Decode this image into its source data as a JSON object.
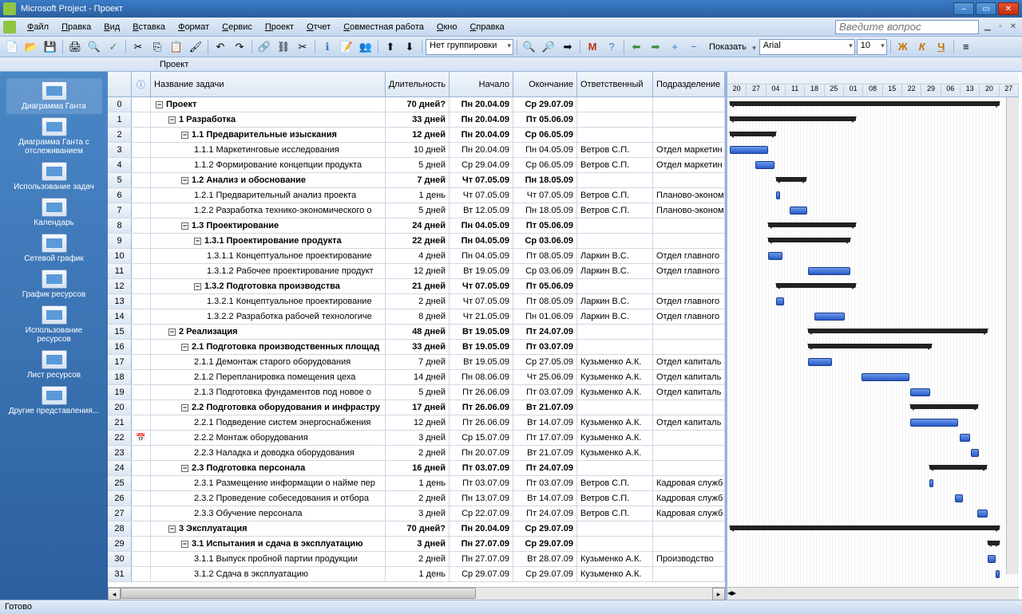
{
  "titlebar": {
    "title": "Microsoft Project - Проект"
  },
  "menu": {
    "items": [
      "Файл",
      "Правка",
      "Вид",
      "Вставка",
      "Формат",
      "Сервис",
      "Проект",
      "Отчет",
      "Совместная работа",
      "Окно",
      "Справка"
    ],
    "question_placeholder": "Введите вопрос"
  },
  "toolbar2": {
    "grouping": "Нет группировки",
    "show_label": "Показать",
    "font_name": "Arial",
    "font_size": "10"
  },
  "docbar": {
    "name": "Проект"
  },
  "sidebar": {
    "items": [
      "Диаграмма Ганта",
      "Диаграмма Ганта с отслеживанием",
      "Использование задач",
      "Календарь",
      "Сетевой график",
      "График ресурсов",
      "Использование ресурсов",
      "Лист ресурсов",
      "Другие представления..."
    ]
  },
  "columns": {
    "info": "",
    "name": "Название задачи",
    "duration": "Длительность",
    "start": "Начало",
    "end": "Окончание",
    "resp": "Ответственный",
    "dept": "Подразделение"
  },
  "gantt_dates": [
    "20",
    "27",
    "04",
    "11",
    "18",
    "25",
    "01",
    "08",
    "15",
    "22",
    "29",
    "06",
    "13",
    "20",
    "27"
  ],
  "tasks": [
    {
      "n": 0,
      "lvl": 0,
      "out": "-",
      "bold": true,
      "name": "Проект",
      "dur": "70 дней?",
      "start": "Пн 20.04.09",
      "end": "Ср 29.07.09",
      "resp": "",
      "dept": "",
      "gtype": "summary",
      "gl": 0,
      "gw": 338
    },
    {
      "n": 1,
      "lvl": 1,
      "out": "-",
      "bold": true,
      "name": "1 Разработка",
      "dur": "33 дней",
      "start": "Пн 20.04.09",
      "end": "Пт 05.06.09",
      "resp": "",
      "dept": "",
      "gtype": "summary",
      "gl": 0,
      "gw": 158
    },
    {
      "n": 2,
      "lvl": 2,
      "out": "-",
      "bold": true,
      "name": "1.1 Предварительные изыскания",
      "dur": "12 дней",
      "start": "Пн 20.04.09",
      "end": "Ср 06.05.09",
      "resp": "",
      "dept": "",
      "gtype": "summary",
      "gl": 0,
      "gw": 58
    },
    {
      "n": 3,
      "lvl": 3,
      "out": "",
      "bold": false,
      "name": "1.1.1 Маркетинговые исследования",
      "dur": "10 дней",
      "start": "Пн 20.04.09",
      "end": "Пн 04.05.09",
      "resp": "Ветров С.П.",
      "dept": "Отдел маркетин",
      "gtype": "task",
      "gl": 0,
      "gw": 48
    },
    {
      "n": 4,
      "lvl": 3,
      "out": "",
      "bold": false,
      "name": "1.1.2 Формирование концепции продукта",
      "dur": "5 дней",
      "start": "Ср 29.04.09",
      "end": "Ср 06.05.09",
      "resp": "Ветров С.П.",
      "dept": "Отдел маркетин",
      "gtype": "task",
      "gl": 32,
      "gw": 24
    },
    {
      "n": 5,
      "lvl": 2,
      "out": "-",
      "bold": true,
      "name": "1.2 Анализ и обоснование",
      "dur": "7 дней",
      "start": "Чт 07.05.09",
      "end": "Пн 18.05.09",
      "resp": "",
      "dept": "",
      "gtype": "summary",
      "gl": 58,
      "gw": 38
    },
    {
      "n": 6,
      "lvl": 3,
      "out": "",
      "bold": false,
      "name": "1.2.1 Предварительный анализ проекта",
      "dur": "1 день",
      "start": "Чт 07.05.09",
      "end": "Чт 07.05.09",
      "resp": "Ветров С.П.",
      "dept": "Планово-эконом",
      "gtype": "task",
      "gl": 58,
      "gw": 5
    },
    {
      "n": 7,
      "lvl": 3,
      "out": "",
      "bold": false,
      "name": "1.2.2 Разработка технико-экономического о",
      "dur": "5 дней",
      "start": "Вт 12.05.09",
      "end": "Пн 18.05.09",
      "resp": "Ветров С.П.",
      "dept": "Планово-эконом",
      "gtype": "task",
      "gl": 75,
      "gw": 22
    },
    {
      "n": 8,
      "lvl": 2,
      "out": "-",
      "bold": true,
      "name": "1.3 Проектирование",
      "dur": "24 дней",
      "start": "Пн 04.05.09",
      "end": "Пт 05.06.09",
      "resp": "",
      "dept": "",
      "gtype": "summary",
      "gl": 48,
      "gw": 110
    },
    {
      "n": 9,
      "lvl": 3,
      "out": "-",
      "bold": true,
      "name": "1.3.1 Проектирование продукта",
      "dur": "22 дней",
      "start": "Пн 04.05.09",
      "end": "Ср 03.06.09",
      "resp": "",
      "dept": "",
      "gtype": "summary",
      "gl": 48,
      "gw": 103
    },
    {
      "n": 10,
      "lvl": 4,
      "out": "",
      "bold": false,
      "name": "1.3.1.1 Концептуальное проектирование",
      "dur": "4 дней",
      "start": "Пн 04.05.09",
      "end": "Пт 08.05.09",
      "resp": "Ларкин В.С.",
      "dept": "Отдел главного",
      "gtype": "task",
      "gl": 48,
      "gw": 18
    },
    {
      "n": 11,
      "lvl": 4,
      "out": "",
      "bold": false,
      "name": "1.3.1.2 Рабочее проектирование продукт",
      "dur": "12 дней",
      "start": "Вт 19.05.09",
      "end": "Ср 03.06.09",
      "resp": "Ларкин В.С.",
      "dept": "Отдел главного",
      "gtype": "task",
      "gl": 98,
      "gw": 53
    },
    {
      "n": 12,
      "lvl": 3,
      "out": "-",
      "bold": true,
      "name": "1.3.2 Подготовка производства",
      "dur": "21 дней",
      "start": "Чт 07.05.09",
      "end": "Пт 05.06.09",
      "resp": "",
      "dept": "",
      "gtype": "summary",
      "gl": 58,
      "gw": 100
    },
    {
      "n": 13,
      "lvl": 4,
      "out": "",
      "bold": false,
      "name": "1.3.2.1 Концептуальное проектирование",
      "dur": "2 дней",
      "start": "Чт 07.05.09",
      "end": "Пт 08.05.09",
      "resp": "Ларкин В.С.",
      "dept": "Отдел главного",
      "gtype": "task",
      "gl": 58,
      "gw": 10
    },
    {
      "n": 14,
      "lvl": 4,
      "out": "",
      "bold": false,
      "name": "1.3.2.2 Разработка рабочей технологиче",
      "dur": "8 дней",
      "start": "Чт 21.05.09",
      "end": "Пн 01.06.09",
      "resp": "Ларкин В.С.",
      "dept": "Отдел главного",
      "gtype": "task",
      "gl": 106,
      "gw": 38
    },
    {
      "n": 15,
      "lvl": 1,
      "out": "-",
      "bold": true,
      "name": "2 Реализация",
      "dur": "48 дней",
      "start": "Вт 19.05.09",
      "end": "Пт 24.07.09",
      "resp": "",
      "dept": "",
      "gtype": "summary",
      "gl": 98,
      "gw": 225
    },
    {
      "n": 16,
      "lvl": 2,
      "out": "-",
      "bold": true,
      "name": "2.1 Подготовка производственных площад",
      "dur": "33 дней",
      "start": "Вт 19.05.09",
      "end": "Пт 03.07.09",
      "resp": "",
      "dept": "",
      "gtype": "summary",
      "gl": 98,
      "gw": 155
    },
    {
      "n": 17,
      "lvl": 3,
      "out": "",
      "bold": false,
      "name": "2.1.1 Демонтаж старого оборудования",
      "dur": "7 дней",
      "start": "Вт 19.05.09",
      "end": "Ср 27.05.09",
      "resp": "Кузьменко А.К.",
      "dept": "Отдел капиталь",
      "gtype": "task",
      "gl": 98,
      "gw": 30
    },
    {
      "n": 18,
      "lvl": 3,
      "out": "",
      "bold": false,
      "name": "2.1.2 Перепланировка помещения цеха",
      "dur": "14 дней",
      "start": "Пн 08.06.09",
      "end": "Чт 25.06.09",
      "resp": "Кузьменко А.К.",
      "dept": "Отдел капиталь",
      "gtype": "task",
      "gl": 165,
      "gw": 60
    },
    {
      "n": 19,
      "lvl": 3,
      "out": "",
      "bold": false,
      "name": "2.1.3 Подготовка фундаментов под новое о",
      "dur": "5 дней",
      "start": "Пт 26.06.09",
      "end": "Пт 03.07.09",
      "resp": "Кузьменко А.К.",
      "dept": "Отдел капиталь",
      "gtype": "task",
      "gl": 226,
      "gw": 25
    },
    {
      "n": 20,
      "lvl": 2,
      "out": "-",
      "bold": true,
      "name": "2.2 Подготовка оборудования и инфрастру",
      "dur": "17 дней",
      "start": "Пт 26.06.09",
      "end": "Вт 21.07.09",
      "resp": "",
      "dept": "",
      "gtype": "summary",
      "gl": 226,
      "gw": 85
    },
    {
      "n": 21,
      "lvl": 3,
      "out": "",
      "bold": false,
      "name": "2.2.1 Подведение систем энергоснабжения",
      "dur": "12 дней",
      "start": "Пт 26.06.09",
      "end": "Вт 14.07.09",
      "resp": "Кузьменко А.К.",
      "dept": "Отдел капиталь",
      "gtype": "task",
      "gl": 226,
      "gw": 60
    },
    {
      "n": 22,
      "lvl": 3,
      "out": "",
      "bold": false,
      "name": "2.2.2 Монтаж оборудования",
      "dur": "3 дней",
      "start": "Ср 15.07.09",
      "end": "Пт 17.07.09",
      "resp": "Кузьменко А.К.",
      "dept": "",
      "gtype": "task",
      "gl": 288,
      "gw": 13,
      "icon": "cal"
    },
    {
      "n": 23,
      "lvl": 3,
      "out": "",
      "bold": false,
      "name": "2.2.3 Наладка и доводка оборудования",
      "dur": "2 дней",
      "start": "Пн 20.07.09",
      "end": "Вт 21.07.09",
      "resp": "Кузьменко А.К.",
      "dept": "",
      "gtype": "task",
      "gl": 302,
      "gw": 10
    },
    {
      "n": 24,
      "lvl": 2,
      "out": "-",
      "bold": true,
      "name": "2.3 Подготовка персонала",
      "dur": "16 дней",
      "start": "Пт 03.07.09",
      "end": "Пт 24.07.09",
      "resp": "",
      "dept": "",
      "gtype": "summary",
      "gl": 250,
      "gw": 72
    },
    {
      "n": 25,
      "lvl": 3,
      "out": "",
      "bold": false,
      "name": "2.3.1 Размещение информации о найме пер",
      "dur": "1 день",
      "start": "Пт 03.07.09",
      "end": "Пт 03.07.09",
      "resp": "Ветров С.П.",
      "dept": "Кадровая служб",
      "gtype": "task",
      "gl": 250,
      "gw": 5
    },
    {
      "n": 26,
      "lvl": 3,
      "out": "",
      "bold": false,
      "name": "2.3.2 Проведение собеседования и отбора",
      "dur": "2 дней",
      "start": "Пн 13.07.09",
      "end": "Вт 14.07.09",
      "resp": "Ветров С.П.",
      "dept": "Кадровая служб",
      "gtype": "task",
      "gl": 282,
      "gw": 10
    },
    {
      "n": 27,
      "lvl": 3,
      "out": "",
      "bold": false,
      "name": "2.3.3 Обучение персонала",
      "dur": "3 дней",
      "start": "Ср 22.07.09",
      "end": "Пт 24.07.09",
      "resp": "Ветров С.П.",
      "dept": "Кадровая служб",
      "gtype": "task",
      "gl": 310,
      "gw": 13
    },
    {
      "n": 28,
      "lvl": 1,
      "out": "-",
      "bold": true,
      "name": "3 Эксплуатация",
      "dur": "70 дней?",
      "start": "Пн 20.04.09",
      "end": "Ср 29.07.09",
      "resp": "",
      "dept": "",
      "gtype": "summary",
      "gl": 0,
      "gw": 338
    },
    {
      "n": 29,
      "lvl": 2,
      "out": "-",
      "bold": true,
      "name": "3.1 Испытания и сдача в эксплуатацию",
      "dur": "3 дней",
      "start": "Пн 27.07.09",
      "end": "Ср 29.07.09",
      "resp": "",
      "dept": "",
      "gtype": "summary",
      "gl": 323,
      "gw": 15
    },
    {
      "n": 30,
      "lvl": 3,
      "out": "",
      "bold": false,
      "name": "3.1.1 Выпуск пробной партии продукции",
      "dur": "2 дней",
      "start": "Пн 27.07.09",
      "end": "Вт 28.07.09",
      "resp": "Кузьменко А.К.",
      "dept": "Производство",
      "gtype": "task",
      "gl": 323,
      "gw": 10
    },
    {
      "n": 31,
      "lvl": 3,
      "out": "",
      "bold": false,
      "name": "3.1.2 Сдача в эксплуатацию",
      "dur": "1 день",
      "start": "Ср 29.07.09",
      "end": "Ср 29.07.09",
      "resp": "Кузьменко А.К.",
      "dept": "",
      "gtype": "task",
      "gl": 333,
      "gw": 5
    }
  ],
  "statusbar": {
    "text": "Готово"
  }
}
